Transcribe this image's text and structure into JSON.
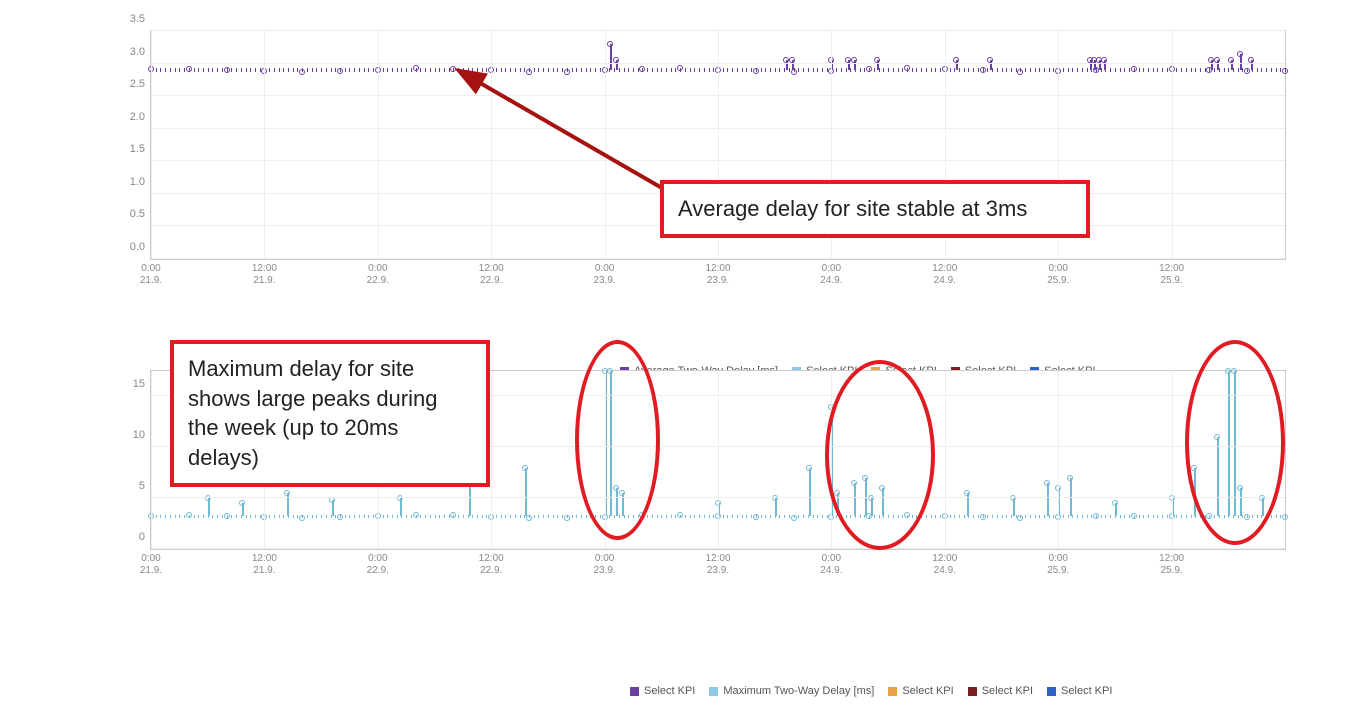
{
  "chart_data": [
    {
      "type": "line",
      "title": "",
      "xlabel": "",
      "ylabel": "",
      "ylim": [
        0,
        3.5
      ],
      "yticks": [
        0.0,
        0.5,
        1.0,
        1.5,
        2.0,
        2.5,
        3.0,
        3.5
      ],
      "x_ticks": [
        {
          "time": "0:00",
          "date": "21.9."
        },
        {
          "time": "12:00",
          "date": "21.9."
        },
        {
          "time": "0:00",
          "date": "22.9."
        },
        {
          "time": "12:00",
          "date": "22.9."
        },
        {
          "time": "0:00",
          "date": "23.9."
        },
        {
          "time": "12:00",
          "date": "23.9."
        },
        {
          "time": "0:00",
          "date": "24.9."
        },
        {
          "time": "12:00",
          "date": "24.9."
        },
        {
          "time": "0:00",
          "date": "25.9."
        },
        {
          "time": "12:00",
          "date": "25.9."
        }
      ],
      "series": [
        {
          "name": "Average Two-Way Delay [ms]",
          "color": "#6b3fa0",
          "baseline": 2.9,
          "spikes": [
            {
              "x_frac": 0.405,
              "y": 3.3
            },
            {
              "x_frac": 0.41,
              "y": 3.05
            },
            {
              "x_frac": 0.56,
              "y": 3.05
            },
            {
              "x_frac": 0.565,
              "y": 3.05
            },
            {
              "x_frac": 0.6,
              "y": 3.05
            },
            {
              "x_frac": 0.615,
              "y": 3.05
            },
            {
              "x_frac": 0.62,
              "y": 3.05
            },
            {
              "x_frac": 0.64,
              "y": 3.05
            },
            {
              "x_frac": 0.71,
              "y": 3.05
            },
            {
              "x_frac": 0.74,
              "y": 3.05
            },
            {
              "x_frac": 0.828,
              "y": 3.05
            },
            {
              "x_frac": 0.832,
              "y": 3.05
            },
            {
              "x_frac": 0.836,
              "y": 3.05
            },
            {
              "x_frac": 0.84,
              "y": 3.05
            },
            {
              "x_frac": 0.935,
              "y": 3.05
            },
            {
              "x_frac": 0.94,
              "y": 3.05
            },
            {
              "x_frac": 0.952,
              "y": 3.05
            },
            {
              "x_frac": 0.96,
              "y": 3.15
            },
            {
              "x_frac": 0.97,
              "y": 3.05
            }
          ]
        }
      ],
      "legend": [
        {
          "label": "Average Two-Way Delay [ms]",
          "color": "#6b3fa0"
        },
        {
          "label": "Select KPI",
          "color": "#8cc9e8"
        },
        {
          "label": "Select KPI",
          "color": "#e8a24a"
        },
        {
          "label": "Select KPI",
          "color": "#7a1f1f"
        },
        {
          "label": "Select KPI",
          "color": "#2f62c9"
        }
      ]
    },
    {
      "type": "line",
      "title": "",
      "xlabel": "",
      "ylabel": "",
      "ylim": [
        0,
        17.5
      ],
      "yticks": [
        0,
        5,
        10,
        15
      ],
      "x_ticks": [
        {
          "time": "0:00",
          "date": "21.9."
        },
        {
          "time": "12:00",
          "date": "21.9."
        },
        {
          "time": "0:00",
          "date": "22.9."
        },
        {
          "time": "12:00",
          "date": "22.9."
        },
        {
          "time": "0:00",
          "date": "23.9."
        },
        {
          "time": "12:00",
          "date": "23.9."
        },
        {
          "time": "0:00",
          "date": "24.9."
        },
        {
          "time": "12:00",
          "date": "24.9."
        },
        {
          "time": "0:00",
          "date": "25.9."
        },
        {
          "time": "12:00",
          "date": "25.9."
        }
      ],
      "series": [
        {
          "name": "Maximum Two-Way Delay [ms]",
          "color": "#6fb9d6",
          "baseline": 3.2,
          "spikes": [
            {
              "x_frac": 0.05,
              "y": 5.0
            },
            {
              "x_frac": 0.08,
              "y": 4.5
            },
            {
              "x_frac": 0.12,
              "y": 5.5
            },
            {
              "x_frac": 0.16,
              "y": 4.8
            },
            {
              "x_frac": 0.22,
              "y": 5.0
            },
            {
              "x_frac": 0.28,
              "y": 6.5
            },
            {
              "x_frac": 0.33,
              "y": 8.0
            },
            {
              "x_frac": 0.4,
              "y": 17.5
            },
            {
              "x_frac": 0.405,
              "y": 17.5
            },
            {
              "x_frac": 0.41,
              "y": 6.0
            },
            {
              "x_frac": 0.415,
              "y": 5.5
            },
            {
              "x_frac": 0.5,
              "y": 4.5
            },
            {
              "x_frac": 0.55,
              "y": 5.0
            },
            {
              "x_frac": 0.58,
              "y": 8.0
            },
            {
              "x_frac": 0.6,
              "y": 14.0
            },
            {
              "x_frac": 0.605,
              "y": 5.5
            },
            {
              "x_frac": 0.62,
              "y": 6.5
            },
            {
              "x_frac": 0.63,
              "y": 7.0
            },
            {
              "x_frac": 0.635,
              "y": 5.0
            },
            {
              "x_frac": 0.645,
              "y": 6.0
            },
            {
              "x_frac": 0.72,
              "y": 5.5
            },
            {
              "x_frac": 0.76,
              "y": 5.0
            },
            {
              "x_frac": 0.79,
              "y": 6.5
            },
            {
              "x_frac": 0.8,
              "y": 6.0
            },
            {
              "x_frac": 0.81,
              "y": 7.0
            },
            {
              "x_frac": 0.85,
              "y": 4.5
            },
            {
              "x_frac": 0.9,
              "y": 5.0
            },
            {
              "x_frac": 0.92,
              "y": 8.0
            },
            {
              "x_frac": 0.94,
              "y": 11.0
            },
            {
              "x_frac": 0.95,
              "y": 17.5
            },
            {
              "x_frac": 0.955,
              "y": 17.5
            },
            {
              "x_frac": 0.96,
              "y": 6.0
            },
            {
              "x_frac": 0.98,
              "y": 5.0
            }
          ]
        }
      ],
      "legend": [
        {
          "label": "Select KPI",
          "color": "#6b3fa0"
        },
        {
          "label": "Maximum Two-Way Delay [ms]",
          "color": "#8cc9e8"
        },
        {
          "label": "Select KPI",
          "color": "#e8a24a"
        },
        {
          "label": "Select KPI",
          "color": "#7a1f1f"
        },
        {
          "label": "Select KPI",
          "color": "#2f62c9"
        }
      ]
    }
  ],
  "annotations": {
    "top": "Average delay for site stable at 3ms",
    "bottom": "Maximum delay for site shows large peaks during the week (up to 20ms delays)"
  },
  "colors": {
    "annotation_red": "#e11b22",
    "purple": "#6b3fa0",
    "lightblue": "#8cc9e8",
    "arrow": "#a6120f"
  }
}
